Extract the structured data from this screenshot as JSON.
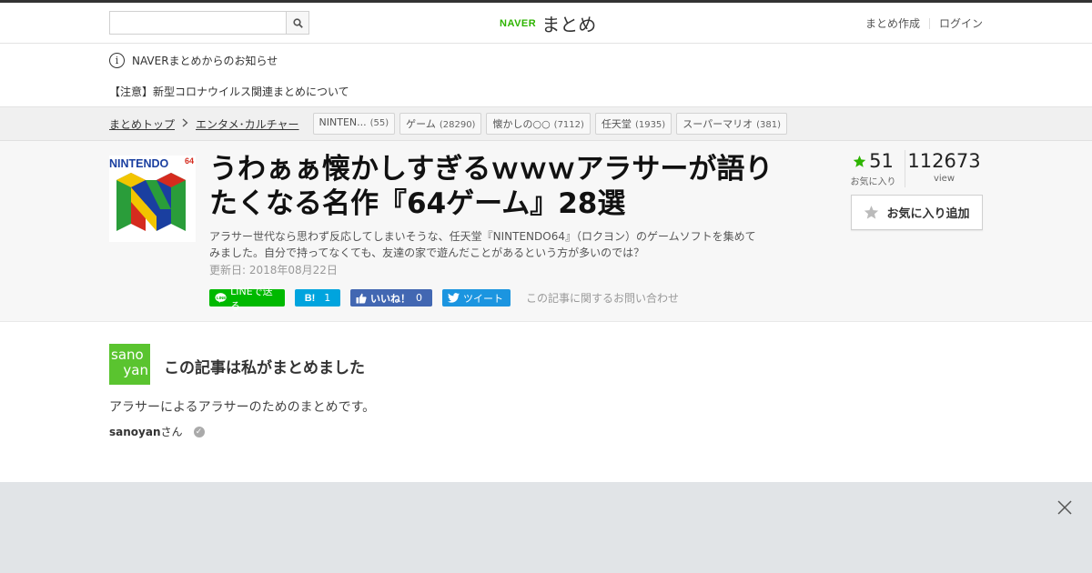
{
  "header": {
    "search_placeholder": "",
    "logo_naver": "NAVER",
    "logo_matome": "まとめ",
    "links": [
      "まとめ作成",
      "ログイン"
    ]
  },
  "notice": {
    "title": "NAVERまとめからのお知らせ",
    "link": "【注意】新型コロナウイルス関連まとめについて"
  },
  "breadcrumb": {
    "items": [
      "まとめトップ",
      "エンタメ･カルチャー"
    ],
    "tags": [
      {
        "label": "NINTEN...",
        "count": "(55)"
      },
      {
        "label": "ゲーム",
        "count": "(28290)"
      },
      {
        "label": "懐かしの○○",
        "count": "(7112)"
      },
      {
        "label": "任天堂",
        "count": "(1935)"
      },
      {
        "label": "スーパーマリオ",
        "count": "(381)"
      }
    ]
  },
  "article": {
    "thumb_text": "NINTENDO",
    "thumb_sup": "64",
    "title": "うわぁぁ懐かしすぎるｗｗｗアラサーが語りたくなる名作『64ゲーム』28選",
    "description": "アラサー世代なら思わず反応してしまいそうな、任天堂『NINTENDO64』（ロクヨン）のゲームソフトを集めてみました。自分で持ってなくても、友達の家で遊んだことがあるという方が多いのでは？",
    "updated": "更新日: 2018年08月22日",
    "social": {
      "line": "LINEで送る",
      "hatena_icon": "B!",
      "hatena_count": "1",
      "fb_label": "いいね！",
      "fb_count": "0",
      "tweet": "ツイート",
      "contact": "この記事に関するお問い合わせ"
    },
    "stats": {
      "favorites": "51",
      "favorites_label": "お気に入り",
      "views": "112673",
      "views_label": "view"
    },
    "fav_button": "お気に入り追加"
  },
  "author": {
    "avatar_line1": "sano",
    "avatar_line2": "yan",
    "heading": "この記事は私がまとめました",
    "description": "アラサーによるアラサーのためのまとめです。",
    "name": "sanoyan",
    "suffix": "さん"
  },
  "colors": {
    "brand_green": "#2db400",
    "line_green": "#00b900",
    "hatena_blue": "#00a4de",
    "facebook_blue": "#4267b2",
    "twitter_blue": "#1b95e0",
    "ad_background": "#e1e4e7"
  }
}
